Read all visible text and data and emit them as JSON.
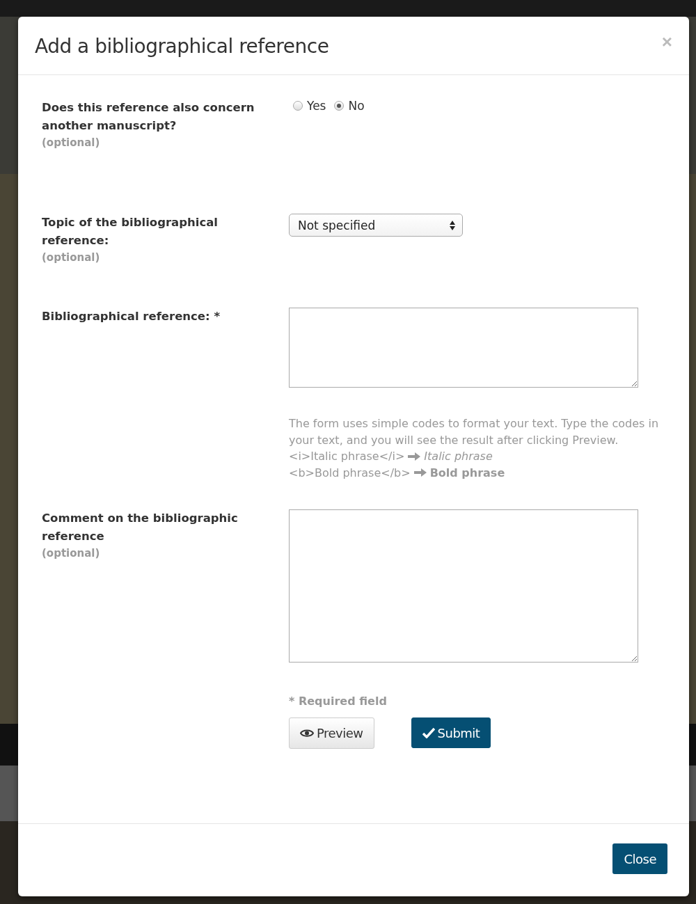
{
  "dialog": {
    "title": "Add a bibliographical reference",
    "close_icon": "×"
  },
  "fields": [
    {
      "kind": "radio",
      "label": "Does this reference also concern another manuscript?",
      "note": "(optional)",
      "options": [
        {
          "label": "Yes",
          "selected": false
        },
        {
          "label": "No",
          "selected": true
        }
      ]
    },
    {
      "kind": "select",
      "label": "Topic of the bibliographical reference:",
      "note": "(optional)",
      "value": "Not specified"
    },
    {
      "kind": "textarea",
      "label": "Bibliographical reference: *",
      "help": {
        "text": "The form uses simple codes to format your text. Type the codes in your text, and you will see the result after clicking Preview.",
        "examples": [
          {
            "code": "<i>Italic phrase</i>",
            "result": "Italic phrase",
            "kind": "italic"
          },
          {
            "code": "<b>Bold phrase</b>",
            "result": "Bold phrase",
            "kind": "bold"
          }
        ]
      }
    },
    {
      "kind": "textarea",
      "label": "Comment on the bibliographic reference",
      "note": "(optional)"
    }
  ],
  "required_note": "* Required field",
  "buttons": [
    {
      "label": "Preview",
      "kind": "default"
    },
    {
      "label": "Submit",
      "kind": "primary"
    }
  ],
  "footer": {
    "close_button": "Close"
  }
}
